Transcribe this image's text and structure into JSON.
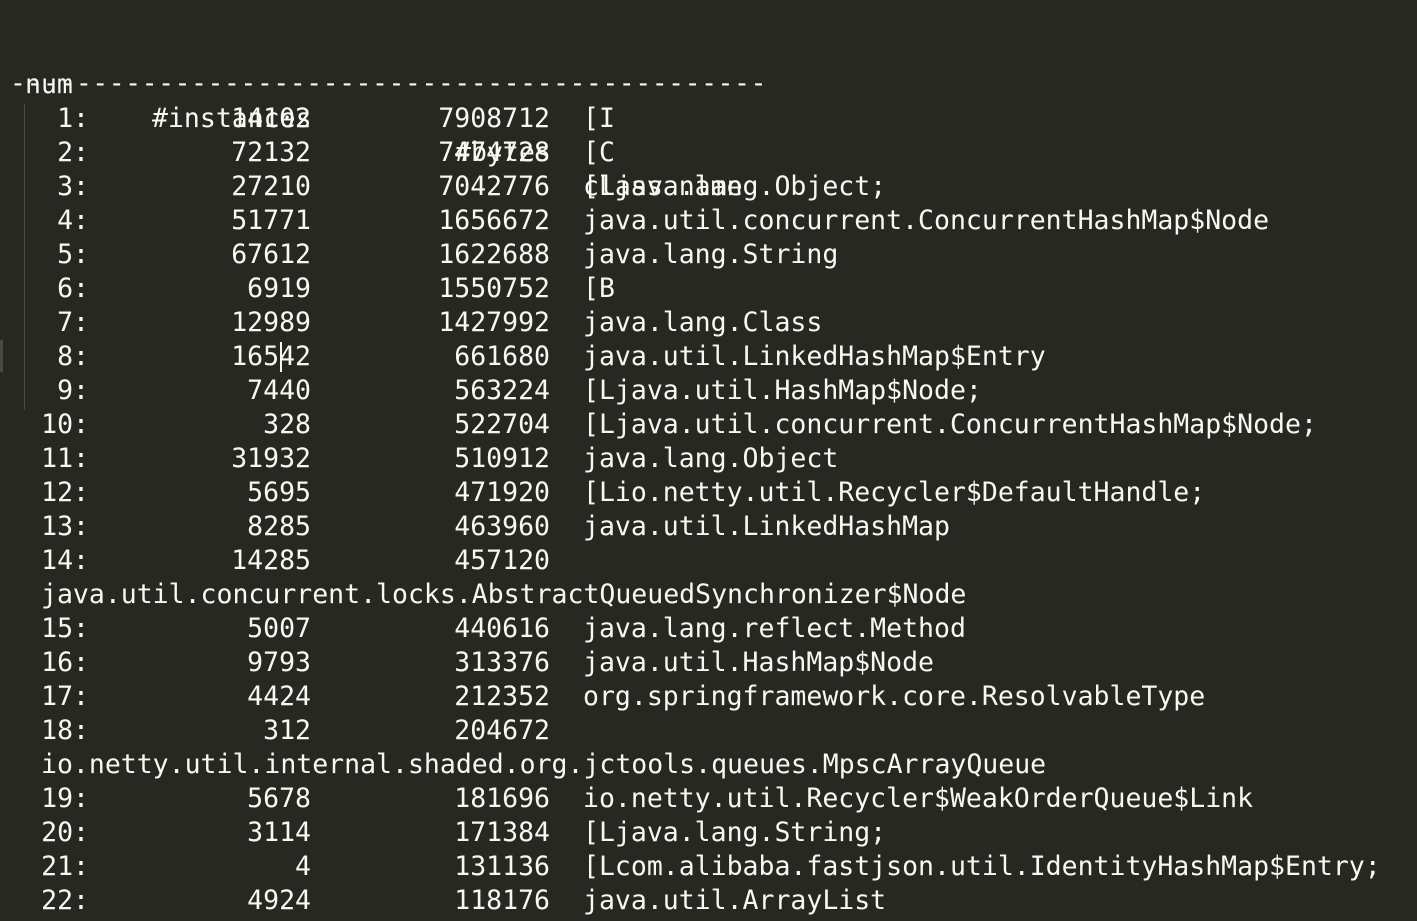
{
  "header": {
    "num": "num",
    "instances": "#instances",
    "bytes": "#bytes",
    "class_name": "class name"
  },
  "separator": "----------------------------------------------",
  "rows": [
    {
      "num": "1:",
      "instances": "14102",
      "bytes": "7908712",
      "class_name": "[I"
    },
    {
      "num": "2:",
      "instances": "72132",
      "bytes": "7474728",
      "class_name": "[C"
    },
    {
      "num": "3:",
      "instances": "27210",
      "bytes": "7042776",
      "class_name": "[Ljava.lang.Object;"
    },
    {
      "num": "4:",
      "instances": "51771",
      "bytes": "1656672",
      "class_name": "java.util.concurrent.ConcurrentHashMap$Node"
    },
    {
      "num": "5:",
      "instances": "67612",
      "bytes": "1622688",
      "class_name": "java.lang.String"
    },
    {
      "num": "6:",
      "instances": "6919",
      "bytes": "1550752",
      "class_name": "[B"
    },
    {
      "num": "7:",
      "instances": "12989",
      "bytes": "1427992",
      "class_name": "java.lang.Class"
    },
    {
      "num": "8:",
      "instances": "16542",
      "bytes": "661680",
      "class_name": "java.util.LinkedHashMap$Entry"
    },
    {
      "num": "9:",
      "instances": "7440",
      "bytes": "563224",
      "class_name": "[Ljava.util.HashMap$Node;"
    },
    {
      "num": "10:",
      "instances": "328",
      "bytes": "522704",
      "class_name": "[Ljava.util.concurrent.ConcurrentHashMap$Node;"
    },
    {
      "num": "11:",
      "instances": "31932",
      "bytes": "510912",
      "class_name": "java.lang.Object"
    },
    {
      "num": "12:",
      "instances": "5695",
      "bytes": "471920",
      "class_name": "[Lio.netty.util.Recycler$DefaultHandle;"
    },
    {
      "num": "13:",
      "instances": "8285",
      "bytes": "463960",
      "class_name": "java.util.LinkedHashMap"
    },
    {
      "num": "14:",
      "instances": "14285",
      "bytes": "457120",
      "class_name": ""
    },
    {
      "num": "15:",
      "instances": "5007",
      "bytes": "440616",
      "class_name": "java.lang.reflect.Method"
    },
    {
      "num": "16:",
      "instances": "9793",
      "bytes": "313376",
      "class_name": "java.util.HashMap$Node"
    },
    {
      "num": "17:",
      "instances": "4424",
      "bytes": "212352",
      "class_name": "org.springframework.core.ResolvableType"
    },
    {
      "num": "18:",
      "instances": "312",
      "bytes": "204672",
      "class_name": ""
    },
    {
      "num": "19:",
      "instances": "5678",
      "bytes": "181696",
      "class_name": "io.netty.util.Recycler$WeakOrderQueue$Link"
    },
    {
      "num": "20:",
      "instances": "3114",
      "bytes": "171384",
      "class_name": "[Ljava.lang.String;"
    },
    {
      "num": "21:",
      "instances": "4",
      "bytes": "131136",
      "class_name": "[Lcom.alibaba.fastjson.util.IdentityHashMap$Entry;"
    },
    {
      "num": "22:",
      "instances": "4924",
      "bytes": "118176",
      "class_name": "java.util.ArrayList"
    }
  ],
  "wrapped": {
    "after_14": "java.util.concurrent.locks.AbstractQueuedSynchronizer$Node",
    "after_18": "io.netty.util.internal.shaded.org.jctools.queues.MpscArrayQueue"
  }
}
